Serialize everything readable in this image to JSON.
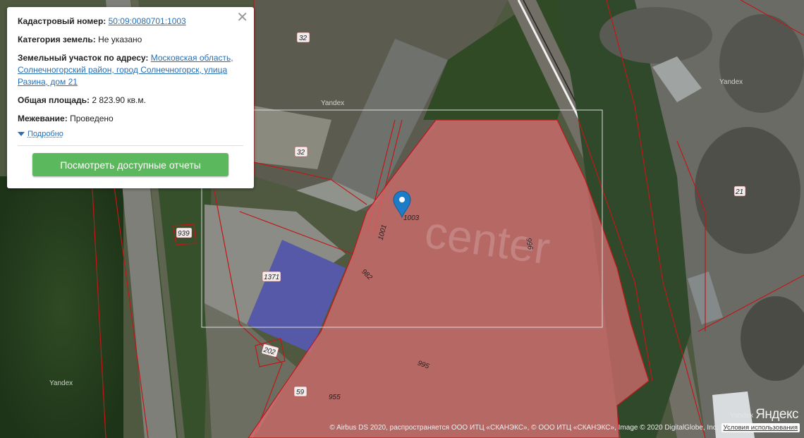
{
  "popup": {
    "cadastral_label": "Кадастровый номер:",
    "cadastral_value": "50:09:0080701:1003",
    "category_label": "Категория земель:",
    "category_value": "Не указано",
    "address_label": "Земельный участок по адресу:",
    "address_value": "Московская область, Солнечногорский район, город Солнечногорск, улица Разина, дом 21",
    "area_label": "Общая площадь:",
    "area_value": "2 823.90 кв.м.",
    "survey_label": "Межевание:",
    "survey_value": "Проведено",
    "details_link": "Подробно",
    "reports_button": "Посмотреть доступные отчеты",
    "close_glyph": "✕"
  },
  "map": {
    "parcel_labels": {
      "p32a": "32",
      "p32b": "32",
      "p939": "939",
      "p1371": "1371",
      "p202": "202",
      "p59": "59",
      "p955": "955",
      "p995": "995",
      "p982": "982",
      "p1001": "1001",
      "p1003": "1003",
      "p996": "996",
      "p21": "21"
    },
    "watermarks": {
      "w1": "Yandex",
      "w2": "Yandex",
      "w3": "Yandex",
      "w4": "Yandex"
    },
    "center_watermark": "center",
    "selected_parcel_color": "#e87078",
    "boundary_color": "#c01818",
    "marker_color": "#1e7bc7"
  },
  "attribution": {
    "text": "© Airbus DS 2020, распространяется ООО ИТЦ «СКАНЭКС», © ООО ИТЦ «СКАНЭКС», Image © 2020 DigitalGlobe, Inc.",
    "terms": "Условия использования",
    "logo": "Яндекс"
  }
}
